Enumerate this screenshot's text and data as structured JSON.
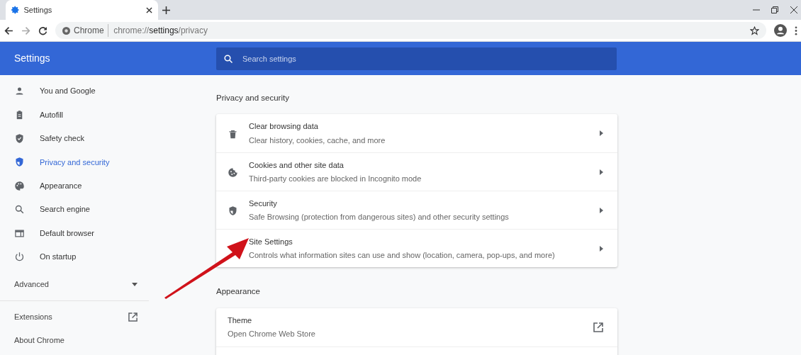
{
  "browser": {
    "tab_title": "Settings",
    "address_label": "Chrome",
    "url_host": "chrome://",
    "url_path": "settings",
    "url_rest": "/privacy"
  },
  "header": {
    "title": "Settings",
    "search": {
      "placeholder": "Search settings"
    }
  },
  "sidebar": {
    "items": [
      {
        "label": "You and Google",
        "selected": false
      },
      {
        "label": "Autofill",
        "selected": false
      },
      {
        "label": "Safety check",
        "selected": false
      },
      {
        "label": "Privacy and security",
        "selected": true
      },
      {
        "label": "Appearance",
        "selected": false
      },
      {
        "label": "Search engine",
        "selected": false
      },
      {
        "label": "Default browser",
        "selected": false
      },
      {
        "label": "On startup",
        "selected": false
      }
    ],
    "advanced": {
      "label": "Advanced",
      "expanded": false
    },
    "links": [
      {
        "label": "Extensions",
        "kind": "external"
      },
      {
        "label": "About Chrome",
        "kind": "plain"
      }
    ]
  },
  "sections": [
    {
      "title": "Privacy and security",
      "rows": [
        {
          "title": "Clear browsing data",
          "subtitle": "Clear history, cookies, cache, and more",
          "kind": "arrow"
        },
        {
          "title": "Cookies and other site data",
          "subtitle": "Third-party cookies are blocked in Incognito mode",
          "kind": "arrow"
        },
        {
          "title": "Security",
          "subtitle": "Safe Browsing (protection from dangerous sites) and other security settings",
          "kind": "arrow"
        },
        {
          "title": "Site Settings",
          "subtitle": "Controls what information sites can use and show (location, camera, pop-ups, and more)",
          "kind": "arrow"
        }
      ]
    },
    {
      "title": "Appearance",
      "rows": [
        {
          "title": "Theme",
          "subtitle": "Open Chrome Web Store",
          "kind": "external"
        }
      ]
    }
  ]
}
